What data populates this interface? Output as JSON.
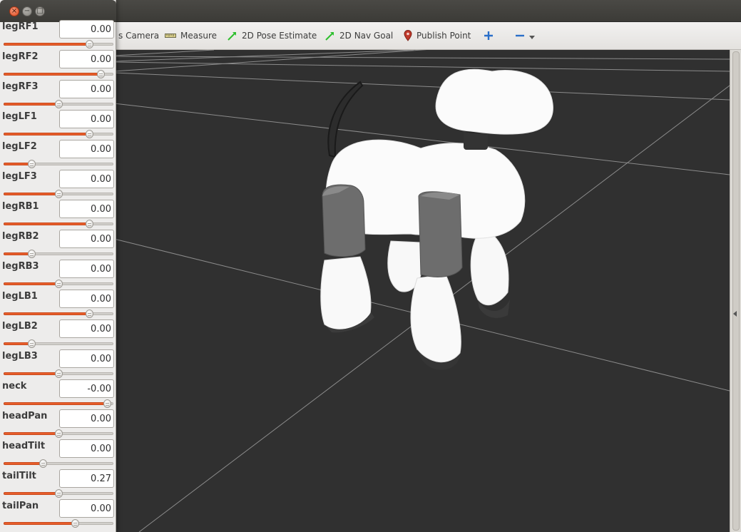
{
  "toolbar": {
    "tools": [
      {
        "label": "s Camera",
        "icon": "camera-icon"
      },
      {
        "label": "Measure",
        "icon": "ruler-icon"
      },
      {
        "label": "2D Pose Estimate",
        "icon": "green-arrow-icon"
      },
      {
        "label": "2D Nav Goal",
        "icon": "green-arrow-icon"
      },
      {
        "label": "Publish Point",
        "icon": "map-pin-icon"
      }
    ],
    "add_icon": "plus-icon",
    "remove_icon": "minus-icon",
    "dropdown_icon": "chevron-down-icon"
  },
  "colors": {
    "slider_fill": "#e85e2b",
    "viewport_bg": "#303030",
    "grid_line": "#8a8a8a",
    "close_button": "#df4a1e",
    "tool_arrow": "#2fbf2f",
    "pin": "#c0392b",
    "plus_blue": "#2a6fc9"
  },
  "window_controls": {
    "close": "×",
    "minimize": "−",
    "maximize": "□"
  },
  "joints": [
    {
      "name": "legRF1",
      "value": "0.00",
      "position": 0.78
    },
    {
      "name": "legRF2",
      "value": "0.00",
      "position": 0.88
    },
    {
      "name": "legRF3",
      "value": "0.00",
      "position": 0.5
    },
    {
      "name": "legLF1",
      "value": "0.00",
      "position": 0.78
    },
    {
      "name": "legLF2",
      "value": "0.00",
      "position": 0.25
    },
    {
      "name": "legLF3",
      "value": "0.00",
      "position": 0.5
    },
    {
      "name": "legRB1",
      "value": "0.00",
      "position": 0.78
    },
    {
      "name": "legRB2",
      "value": "0.00",
      "position": 0.25
    },
    {
      "name": "legRB3",
      "value": "0.00",
      "position": 0.5
    },
    {
      "name": "legLB1",
      "value": "0.00",
      "position": 0.78
    },
    {
      "name": "legLB2",
      "value": "0.00",
      "position": 0.25
    },
    {
      "name": "legLB3",
      "value": "0.00",
      "position": 0.5
    },
    {
      "name": "neck",
      "value": "-0.00",
      "position": 0.94
    },
    {
      "name": "headPan",
      "value": "0.00",
      "position": 0.5
    },
    {
      "name": "headTilt",
      "value": "0.00",
      "position": 0.36
    },
    {
      "name": "tailTilt",
      "value": "0.27",
      "position": 0.5
    },
    {
      "name": "tailPan",
      "value": "0.00",
      "position": 0.65
    }
  ]
}
